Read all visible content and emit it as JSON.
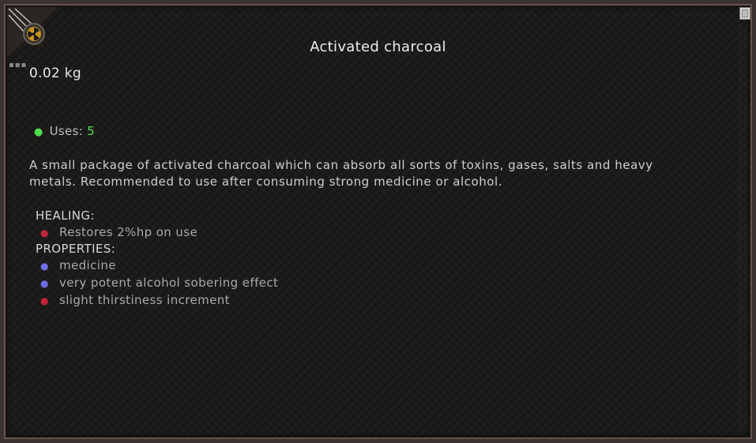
{
  "item": {
    "title": "Activated charcoal",
    "weight": "0.02 kg",
    "uses_label": "Uses:",
    "uses_value": "5",
    "description": "A small package of activated charcoal which can absorb all sorts of toxins, gases, salts and heavy metals. Recommended to use after consuming strong medicine or alcohol."
  },
  "sections": {
    "healing_label": "HEALING:",
    "healing_items": [
      {
        "text": "Restores 2%hp on use",
        "bullet": "red"
      }
    ],
    "properties_label": "PROPERTIES:",
    "properties_items": [
      {
        "text": "medicine",
        "bullet": "blue"
      },
      {
        "text": "very potent alcohol sobering effect",
        "bullet": "blue"
      },
      {
        "text": "slight thirstiness increment",
        "bullet": "red"
      }
    ]
  },
  "colors": {
    "uses_value": "#52e252",
    "bullet_red": "#c1243a",
    "bullet_blue": "#6d6de6"
  },
  "icons": {
    "corner": "radiation-emblem-icon",
    "close": "close-icon"
  }
}
